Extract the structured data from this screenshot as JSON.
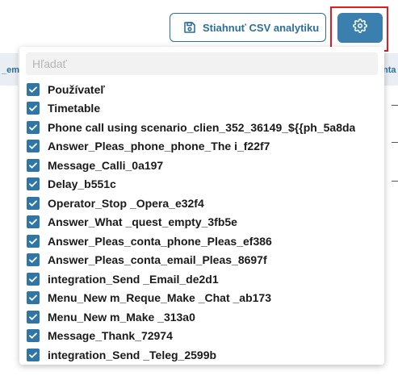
{
  "toolbar": {
    "csv_button_label": "Stiahnuť CSV analytiku",
    "csv_icon": "save-icon",
    "settings_icon": "gear-icon"
  },
  "table_peek": {
    "left_header": "_em",
    "right_header": "nta"
  },
  "dropdown": {
    "search_placeholder": "Hľadať",
    "options": [
      {
        "label": "Používateľ",
        "checked": true
      },
      {
        "label": "Timetable",
        "checked": true
      },
      {
        "label": "Phone call using scenario_clien_352_36149_${{ph_5a8da",
        "checked": true
      },
      {
        "label": "Answer_Pleas_phone_phone_The i_f22f7",
        "checked": true
      },
      {
        "label": "Message_Calli_0a197",
        "checked": true
      },
      {
        "label": "Delay_b551c",
        "checked": true
      },
      {
        "label": "Operator_Stop _Opera_e32f4",
        "checked": true
      },
      {
        "label": "Answer_What _quest_empty_3fb5e",
        "checked": true
      },
      {
        "label": "Answer_Pleas_conta_phone_Pleas_ef386",
        "checked": true
      },
      {
        "label": "Answer_Pleas_conta_email_Pleas_8697f",
        "checked": true
      },
      {
        "label": "integration_Send _Email_de2d1",
        "checked": true
      },
      {
        "label": "Menu_New m_Reque_Make _Chat _ab173",
        "checked": true
      },
      {
        "label": "Menu_New m_Make _313a0",
        "checked": true
      },
      {
        "label": "Message_Thank_72974",
        "checked": true
      },
      {
        "label": "integration_Send _Teleg_2599b",
        "checked": true
      }
    ]
  },
  "colors": {
    "accent": "#2c6f9c",
    "checkbox": "#2f76a6",
    "highlight": "#e01b24"
  }
}
